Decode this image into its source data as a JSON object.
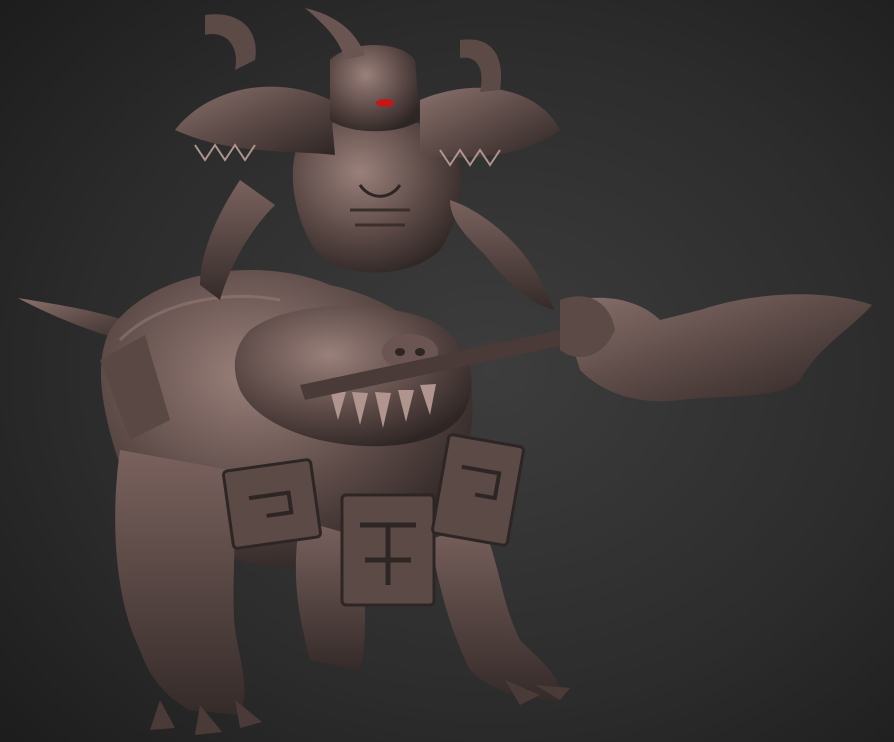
{
  "scene": {
    "subject": "armored-orc-rider-on-boar-beast",
    "colors": {
      "bg_top": "#1f1f1f",
      "bg_mid": "#3a3a3a",
      "bg_bottom": "#2a2a2a",
      "clay_dark": "#2e2624",
      "clay_mid": "#5c4a47",
      "clay_light": "#8a716c",
      "clay_highlight": "#b0958f",
      "eye_glow": "#c41818"
    }
  }
}
